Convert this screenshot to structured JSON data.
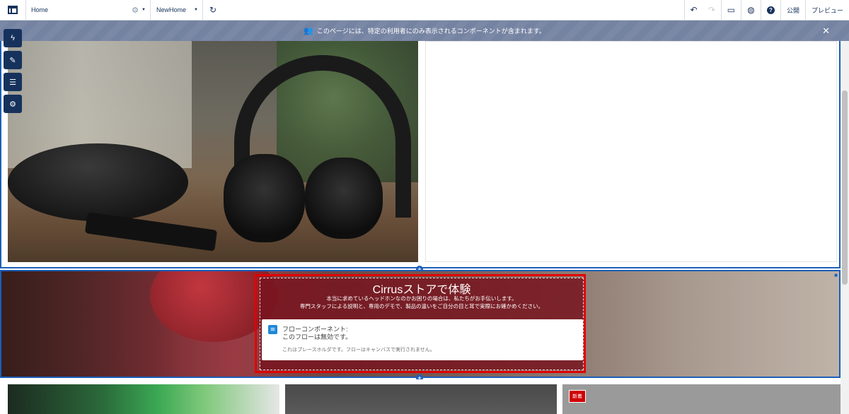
{
  "toolbar": {
    "page_name": "Home",
    "version_name": "NewHome",
    "publish_label": "公開",
    "preview_label": "プレビュー"
  },
  "notice": {
    "text": "このページには、特定の利用者にのみ表示されるコンポーネントが含まれます。",
    "close_glyph": "✕"
  },
  "hero": {},
  "promo": {
    "title": "Cirrusストアで体験",
    "desc_line1": "本当に求めているヘッドホンなのかお困りの場合は、私たちがお手伝いします。",
    "desc_line2": "専門スタッフによる説明と、専用のデモで、製品の違いをご自分の目と耳で実際にお確かめください。",
    "flow_title_line1": "フローコンポーネント:",
    "flow_title_line2": "このフローは無効です。",
    "flow_note": "これはプレースホルダです。フローはキャンバスで実行されません。"
  },
  "cards": {
    "badge_new": "新着"
  },
  "icons": {
    "menu": "menu-icon",
    "settings": "gear-icon",
    "refresh": "refresh-icon",
    "undo": "undo-icon",
    "redo": "redo-icon",
    "desktop": "desktop-icon",
    "language": "globe-icon",
    "help": "help-icon",
    "audience": "audience-icon",
    "close": "close-icon",
    "add": "plus-icon",
    "flow": "flow-icon"
  },
  "colors": {
    "brand_navy": "#16325c",
    "selection_blue": "#1b5fb8",
    "highlight_red": "#e00000",
    "banner": "#7b88a6",
    "badge_red": "#d00000",
    "flow_icon_blue": "#1f87d8"
  }
}
